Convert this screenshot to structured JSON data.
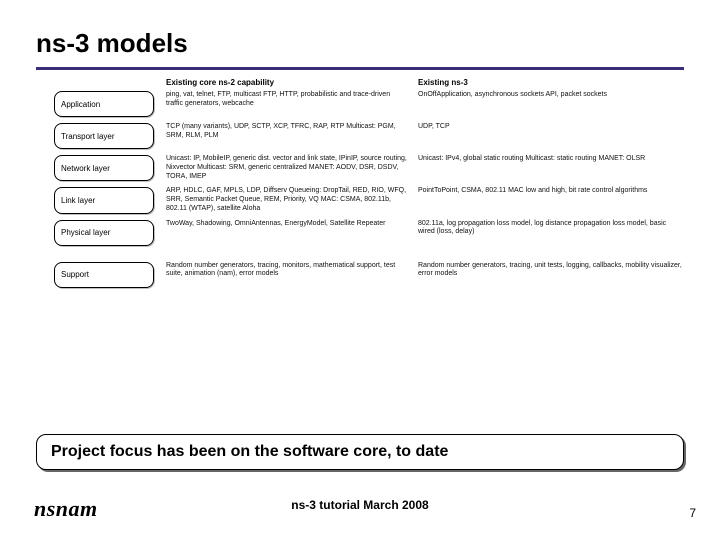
{
  "title": "ns-3 models",
  "headers": {
    "ns2": "Existing core ns-2 capability",
    "ns3": "Existing ns-3"
  },
  "rows": [
    {
      "label": "Application",
      "ns2": "ping, vat, telnet, FTP, multicast FTP, HTTP, probabilistic and trace-driven traffic generators, webcache",
      "ns3": "OnOffApplication, asynchronous sockets API, packet sockets"
    },
    {
      "label": "Transport layer",
      "ns2": "TCP (many variants), UDP, SCTP, XCP, TFRC, RAP, RTP  Multicast: PGM, SRM, RLM, PLM",
      "ns3": "UDP, TCP"
    },
    {
      "label": "Network layer",
      "ns2": "Unicast: IP, MobileIP, generic dist. vector and link state, IPinIP, source routing, Nixvector  Multicast: SRM, generic centralized  MANET: AODV, DSR, DSDV, TORA, IMEP",
      "ns3": "Unicast: IPv4, global static routing  Multicast: static routing  MANET: OLSR"
    },
    {
      "label": "Link layer",
      "ns2": "ARP, HDLC, GAF, MPLS, LDP, Diffserv  Queueing: DropTail, RED, RIO, WFQ, SRR, Semantic Packet Queue, REM, Priority, VQ  MAC: CSMA, 802.11b, 802.11 (WTAP), satellite Aloha",
      "ns3": "PointToPoint, CSMA, 802.11 MAC low and high, bit rate control algorithms"
    },
    {
      "label": "Physical layer",
      "ns2": "TwoWay, Shadowing, OmniAntennas, EnergyModel, Satellite Repeater",
      "ns3": "802.11a, log propagation loss model, log distance propagation loss model, basic wired (loss, delay)"
    },
    {
      "label": "Support",
      "ns2": "Random number generators, tracing, monitors, mathematical support, test suite, animation (nam), error models",
      "ns3": "Random number generators, tracing, unit tests, logging, callbacks, mobility visualizer, error models"
    }
  ],
  "callout": "Project focus has been on the software core, to date",
  "footer": {
    "logo": "nsnam",
    "center": "ns-3 tutorial March 2008",
    "page": "7"
  }
}
